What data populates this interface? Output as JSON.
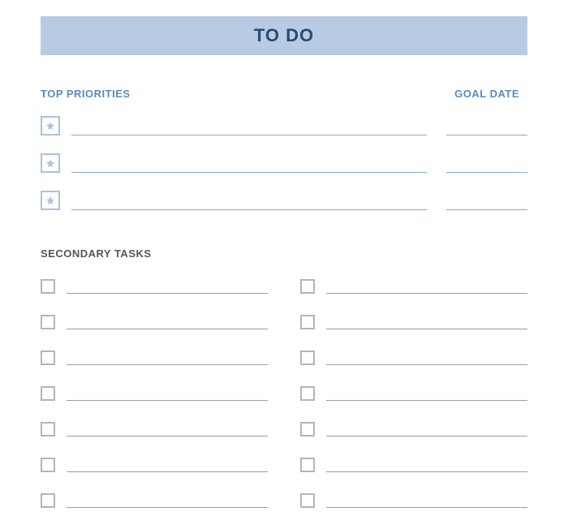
{
  "banner": {
    "title": "TO DO"
  },
  "priorities": {
    "heading": "TOP PRIORITIES",
    "goal_date_label": "GOAL DATE",
    "rows": [
      {
        "text": "",
        "goal_date": ""
      },
      {
        "text": "",
        "goal_date": ""
      },
      {
        "text": "",
        "goal_date": ""
      }
    ]
  },
  "secondary": {
    "heading": "SECONDARY TASKS",
    "left": [
      {
        "text": ""
      },
      {
        "text": ""
      },
      {
        "text": ""
      },
      {
        "text": ""
      },
      {
        "text": ""
      },
      {
        "text": ""
      },
      {
        "text": ""
      }
    ],
    "right": [
      {
        "text": ""
      },
      {
        "text": ""
      },
      {
        "text": ""
      },
      {
        "text": ""
      },
      {
        "text": ""
      },
      {
        "text": ""
      },
      {
        "text": ""
      }
    ]
  },
  "icons": {
    "star": "star-icon",
    "checkbox": "checkbox-icon"
  }
}
